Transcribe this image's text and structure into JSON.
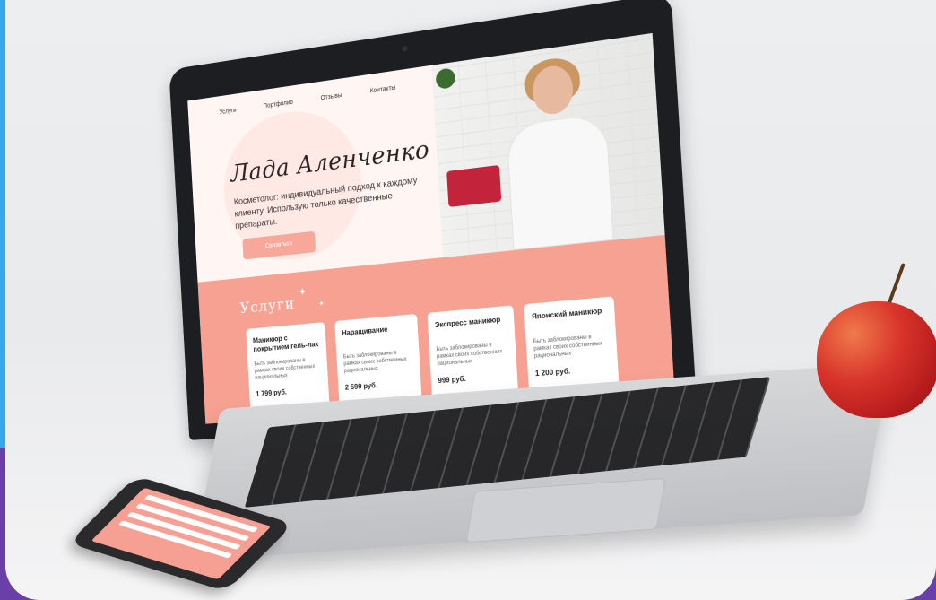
{
  "site": {
    "nav": [
      "Услуги",
      "Портфолио",
      "Отзывы",
      "Контакты"
    ],
    "hero_title": "Лада Аленченко",
    "hero_subtitle": "Косметолог: индивидуальный подход к каждому клиенту. Использую только качественные препараты.",
    "hero_button": "Связаться",
    "services_title": "Услуги",
    "services": [
      {
        "name": "Маникюр с покрытием гель-лак",
        "desc": "Быть заблокированы в рамках своих собственных рациональных",
        "price": "1 799 руб."
      },
      {
        "name": "Наращивание",
        "desc": "Быть заблокированы в рамках своих собственных рациональных",
        "price": "2 599 руб."
      },
      {
        "name": "Экспресс маникюр",
        "desc": "Быть заблокированы в рамках своих собственных рациональных",
        "price": "999 руб."
      },
      {
        "name": "Японский маникюр",
        "desc": "Быть заблокированы в рамках своих собственных рациональных",
        "price": "1 200 руб."
      }
    ]
  },
  "colors": {
    "accent": "#f7a193",
    "hero_bg": "#fff5f2",
    "frame": "#6b3fa8"
  },
  "icons": [
    "sparkle-icon"
  ]
}
